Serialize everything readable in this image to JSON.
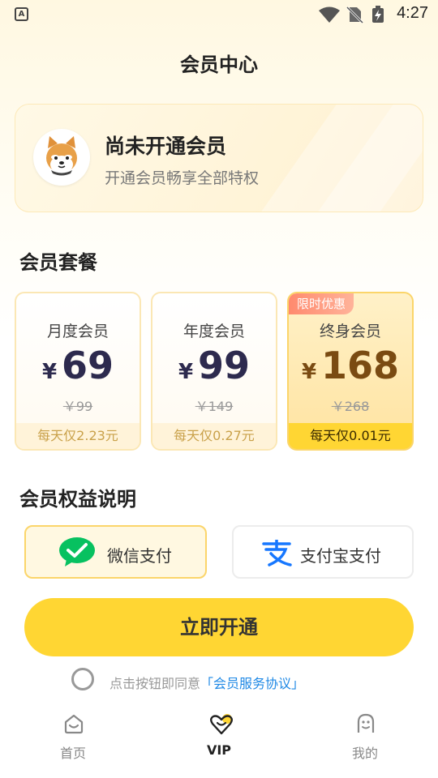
{
  "status_bar": {
    "time": "4:27",
    "app_badge": "A"
  },
  "page": {
    "title": "会员中心"
  },
  "member_card": {
    "title": "尚未开通会员",
    "subtitle": "开通会员畅享全部特权"
  },
  "plans_section": {
    "title": "会员套餐"
  },
  "plans": [
    {
      "name": "月度会员",
      "currency": "¥",
      "price": "69",
      "original": "￥99",
      "daily": "每天仅2.23元",
      "badge": "",
      "selected": false
    },
    {
      "name": "年度会员",
      "currency": "¥",
      "price": "99",
      "original": "￥149",
      "daily": "每天仅0.27元",
      "badge": "",
      "selected": false
    },
    {
      "name": "终身会员",
      "currency": "¥",
      "price": "168",
      "original": "￥268",
      "daily": "每天仅0.01元",
      "badge": "限时优惠",
      "selected": true
    }
  ],
  "benefits_section": {
    "title": "会员权益说明"
  },
  "payment": {
    "wechat_label": "微信支付",
    "alipay_label": "支付宝支付",
    "selected": "wechat"
  },
  "cta": {
    "label": "立即开通"
  },
  "agreement": {
    "prefix": "点击按钮即同意",
    "link": "「会员服务协议」",
    "checked": false
  },
  "bottom_nav": [
    {
      "label": "首页",
      "icon": "home-icon",
      "active": false
    },
    {
      "label": "VIP",
      "icon": "vip-heart-icon",
      "active": true
    },
    {
      "label": "我的",
      "icon": "profile-icon",
      "active": false
    }
  ],
  "colors": {
    "accent": "#ffd633",
    "link": "#1e88e5",
    "badge": "#ff8a6e",
    "wechat": "#07c160",
    "alipay": "#1677ff"
  }
}
